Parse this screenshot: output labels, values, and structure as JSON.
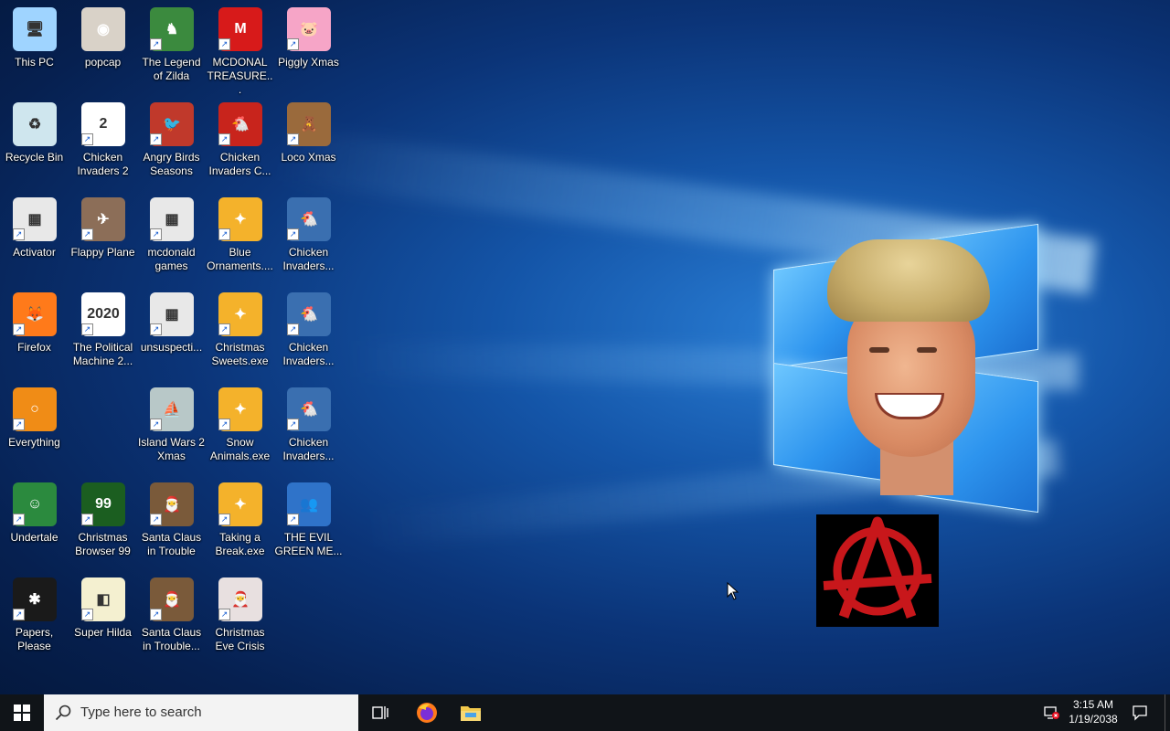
{
  "desktop": {
    "icons": [
      {
        "label": "This PC",
        "icon": "this-pc-icon"
      },
      {
        "label": "popcap",
        "icon": "popcap-icon"
      },
      {
        "label": "The Legend of Zilda",
        "icon": "zilda-icon"
      },
      {
        "label": "MCDONAL TREASURE...",
        "icon": "mcdonalds-icon"
      },
      {
        "label": "Piggly Xmas",
        "icon": "piggly-icon"
      },
      {
        "label": "Recycle Bin",
        "icon": "recycle-bin-icon"
      },
      {
        "label": "Chicken Invaders 2",
        "icon": "chicken-invaders-2-icon",
        "badge": "2"
      },
      {
        "label": "Angry Birds Seasons",
        "icon": "angry-birds-icon"
      },
      {
        "label": "Chicken Invaders C...",
        "icon": "chicken-invaders-c-icon"
      },
      {
        "label": "Loco Xmas",
        "icon": "loco-xmas-icon"
      },
      {
        "label": "Activator",
        "icon": "activator-icon"
      },
      {
        "label": "Flappy Plane",
        "icon": "flappy-plane-icon"
      },
      {
        "label": "mcdonald games",
        "icon": "mcdonald-games-icon"
      },
      {
        "label": "Blue Ornaments....",
        "icon": "blue-ornaments-icon"
      },
      {
        "label": "Chicken Invaders...",
        "icon": "chicken-invaders-icon"
      },
      {
        "label": "Firefox",
        "icon": "firefox-icon"
      },
      {
        "label": "The Political Machine 2...",
        "icon": "political-machine-icon",
        "badge": "2020"
      },
      {
        "label": "unsuspecti...",
        "icon": "unsuspecting-icon"
      },
      {
        "label": "Christmas Sweets.exe",
        "icon": "christmas-sweets-icon"
      },
      {
        "label": "Chicken Invaders...",
        "icon": "chicken-invaders-icon"
      },
      {
        "label": "Everything",
        "icon": "everything-icon"
      },
      {
        "label": "Island Wars 2 Xmas",
        "icon": "island-wars-icon"
      },
      {
        "label": "Snow Animals.exe",
        "icon": "snow-animals-icon"
      },
      {
        "label": "Chicken Invaders...",
        "icon": "chicken-invaders-icon"
      },
      {
        "label": "Undertale",
        "icon": "undertale-icon"
      },
      {
        "label": "Christmas Browser 99",
        "icon": "christmas-browser-icon",
        "badge": "99"
      },
      {
        "label": "Santa Claus in Trouble",
        "icon": "santa-claus-icon"
      },
      {
        "label": "Taking a Break.exe",
        "icon": "taking-a-break-icon"
      },
      {
        "label": "THE EVIL GREEN ME...",
        "icon": "evil-green-icon"
      },
      {
        "label": "Papers, Please",
        "icon": "papers-please-icon"
      },
      {
        "label": "Super Hilda",
        "icon": "super-hilda-icon"
      },
      {
        "label": "Santa Claus in Trouble...",
        "icon": "santa-claus-icon"
      },
      {
        "label": "Christmas Eve Crisis",
        "icon": "christmas-eve-icon"
      }
    ]
  },
  "taskbar": {
    "search_placeholder": "Type here to search",
    "clock_time": "3:15 AM",
    "clock_date": "1/19/2038"
  }
}
